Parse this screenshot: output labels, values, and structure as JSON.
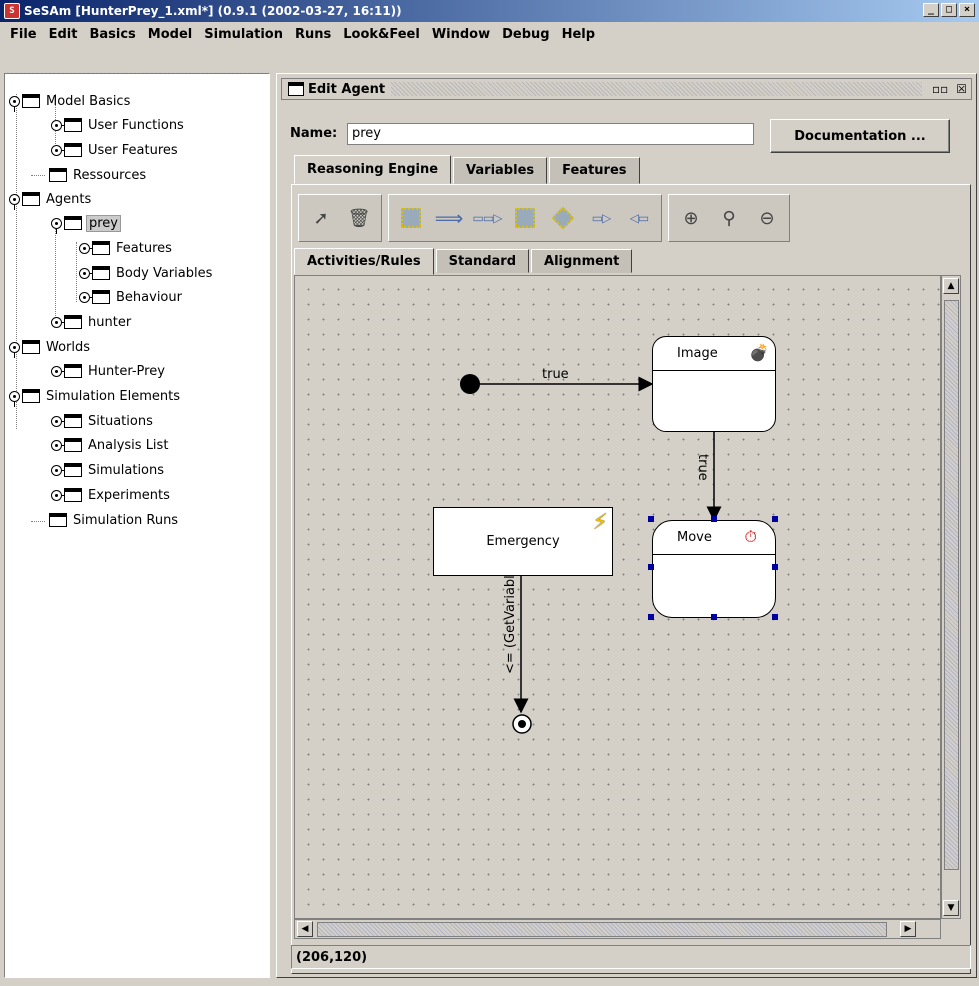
{
  "window": {
    "title": "SeSAm [HunterPrey_1.xml*] (0.9.1 (2002-03-27, 16:11))",
    "controls": [
      "_",
      "□",
      "×"
    ]
  },
  "menu": [
    "File",
    "Edit",
    "Basics",
    "Model",
    "Simulation",
    "Runs",
    "Look&Feel",
    "Window",
    "Debug",
    "Help"
  ],
  "tree": [
    {
      "label": "Model Basics"
    },
    {
      "label": "User Functions"
    },
    {
      "label": "User Features"
    },
    {
      "label": "Ressources"
    },
    {
      "label": "Agents"
    },
    {
      "label": "prey"
    },
    {
      "label": "Features"
    },
    {
      "label": "Body Variables"
    },
    {
      "label": "Behaviour"
    },
    {
      "label": "hunter"
    },
    {
      "label": "Worlds"
    },
    {
      "label": "Hunter-Prey"
    },
    {
      "label": "Simulation Elements"
    },
    {
      "label": "Situations"
    },
    {
      "label": "Analysis List"
    },
    {
      "label": "Simulations"
    },
    {
      "label": "Experiments"
    },
    {
      "label": "Simulation Runs"
    }
  ],
  "editor": {
    "title": "Edit Agent",
    "name_label": "Name:",
    "name_value": "prey",
    "doc_button": "Documentation ...",
    "tabs": [
      "Reasoning Engine",
      "Variables",
      "Features"
    ],
    "subtabs": [
      "Activities/Rules",
      "Standard",
      "Alignment"
    ],
    "status": "(206,120)"
  },
  "diagram": {
    "states": [
      {
        "label": "Image",
        "icon": "bomb-icon"
      },
      {
        "label": "Move",
        "icon": "clock-icon"
      }
    ],
    "activity": {
      "label": "Emergency",
      "icon": "lightning-icon"
    },
    "edges": [
      {
        "label": "true"
      },
      {
        "label": "true"
      },
      {
        "label": "<= (GetVariabl..."
      }
    ]
  }
}
